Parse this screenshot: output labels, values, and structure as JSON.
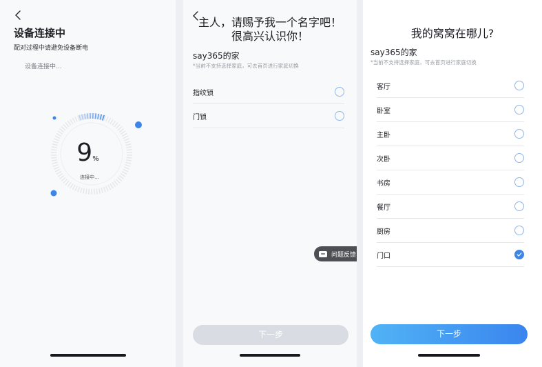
{
  "screen1": {
    "title": "设备连接中",
    "subtitle": "配对过程中请避免设备断电",
    "status": "设备连接中...",
    "progress": 9,
    "progress_unit": "%",
    "ring_label": "连接中..."
  },
  "screen2": {
    "title_line1": "主人，请赐予我一个名字吧！",
    "title_line2": "很高兴认识你！",
    "home_name": "say365的家",
    "hint": "*当前不支持选择家庭，可去首页进行家庭切换",
    "options": [
      {
        "label": "指纹锁",
        "selected": false
      },
      {
        "label": "门锁",
        "selected": false
      }
    ],
    "feedback_label": "问题反馈",
    "next_label": "下一步"
  },
  "screen3": {
    "title": "我的窝窝在哪儿?",
    "home_name": "say365的家",
    "hint": "*当前不支持选择家庭，可去首页进行家庭切换",
    "rooms": [
      {
        "label": "客厅",
        "selected": false
      },
      {
        "label": "卧室",
        "selected": false
      },
      {
        "label": "主卧",
        "selected": false
      },
      {
        "label": "次卧",
        "selected": false
      },
      {
        "label": "书房",
        "selected": false
      },
      {
        "label": "餐厅",
        "selected": false
      },
      {
        "label": "厨房",
        "selected": false
      },
      {
        "label": "门口",
        "selected": true
      }
    ],
    "next_label": "下一步"
  },
  "colors": {
    "accent": "#3e86e6",
    "radio_border": "#8fb6e8",
    "disabled_button": "#d9dce3",
    "button_gradient_start": "#51b3f6",
    "button_gradient_end": "#3a85ee"
  },
  "icons": [
    "back-arrow-icon",
    "radio-icon",
    "check-icon",
    "chat-bubble-icon"
  ]
}
